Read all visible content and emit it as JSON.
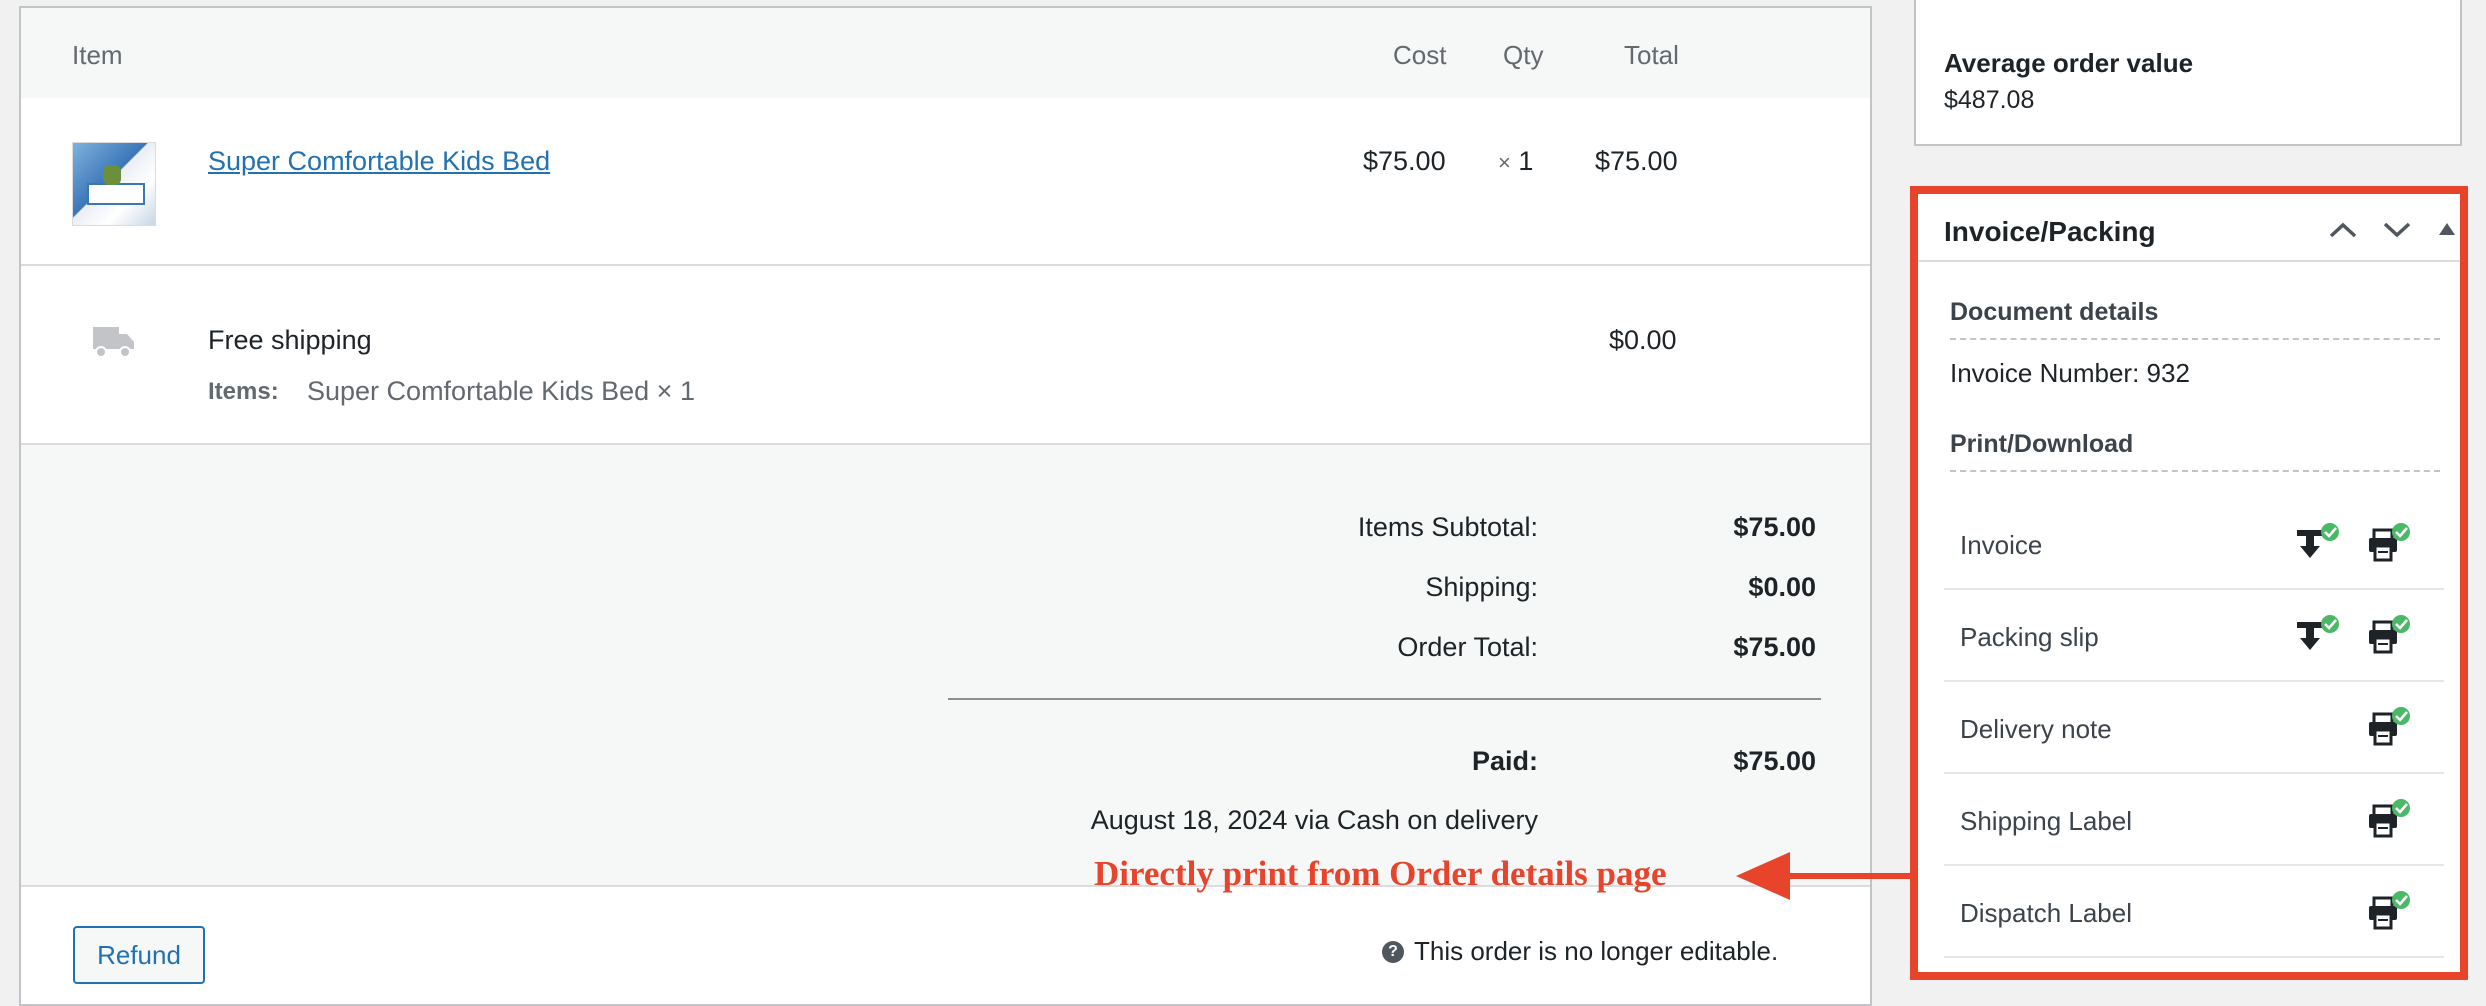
{
  "items_table": {
    "headers": {
      "item": "Item",
      "cost": "Cost",
      "qty": "Qty",
      "total": "Total"
    },
    "line_item": {
      "name": "Super Comfortable Kids Bed",
      "cost": "$75.00",
      "qty": "× 1",
      "total": "$75.00"
    },
    "shipping": {
      "method": "Free shipping",
      "items_label": "Items:",
      "items_value": "Super Comfortable Kids Bed × 1",
      "total": "$0.00"
    }
  },
  "totals": {
    "subtotal_label": "Items Subtotal:",
    "subtotal_value": "$75.00",
    "shipping_label": "Shipping:",
    "shipping_value": "$0.00",
    "order_total_label": "Order Total:",
    "order_total_value": "$75.00",
    "paid_label": "Paid:",
    "paid_value": "$75.00",
    "payment_note": "August 18, 2024 via Cash on delivery"
  },
  "actions": {
    "refund_label": "Refund",
    "not_editable_note": "This order is no longer editable."
  },
  "sidebar": {
    "avg_label": "Average order value",
    "avg_value": "$487.08",
    "invoice_box": {
      "title": "Invoice/Packing",
      "document_details_heading": "Document details",
      "invoice_number_label": "Invoice Number:",
      "invoice_number": "932",
      "print_download_heading": "Print/Download",
      "documents": [
        {
          "label": "Invoice",
          "download": true
        },
        {
          "label": "Packing slip",
          "download": true
        },
        {
          "label": "Delivery note",
          "download": false
        },
        {
          "label": "Shipping Label",
          "download": false
        },
        {
          "label": "Dispatch Label",
          "download": false
        }
      ]
    }
  },
  "annotation": {
    "text": "Directly print from Order details page",
    "color": "#e8432b"
  },
  "colors": {
    "accent": "#2271b1",
    "highlight": "#e8432b",
    "success": "#4ab866"
  }
}
